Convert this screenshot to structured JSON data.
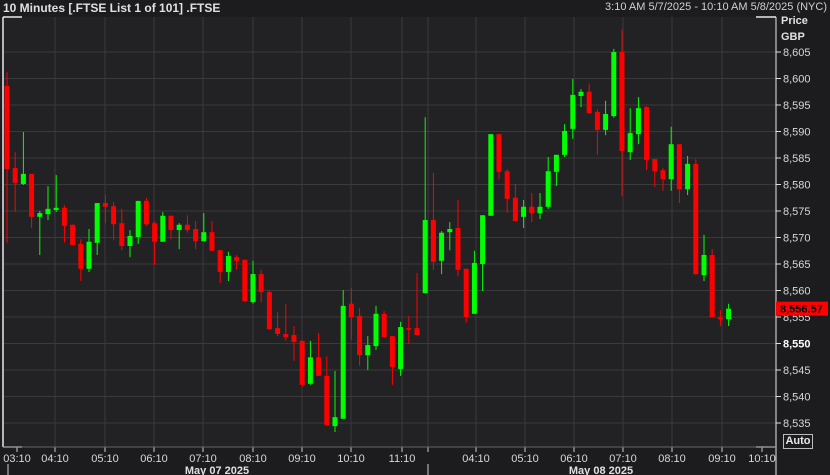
{
  "header": {
    "title": "10 Minutes [.FTSE List 1 of 101] .FTSE",
    "range": "3:10 AM 5/7/2025 - 10:10 AM 5/8/2025 (NYC)"
  },
  "axis": {
    "price_label": "Price",
    "currency_label": "GBP",
    "auto_label": "Auto",
    "last_price_label": "8,556.57",
    "price_ticks": [
      "8,605",
      "8,600",
      "8,595",
      "8,590",
      "8,585",
      "8,580",
      "8,575",
      "8,570",
      "8,565",
      "8,560",
      "8,555",
      "8,550",
      "8,545",
      "8,540",
      "8,535"
    ],
    "time_ticks": [
      "03:10",
      "04:10",
      "05:10",
      "06:10",
      "07:10",
      "08:10",
      "09:10",
      "10:10",
      "11:10",
      "",
      "04:10",
      "05:10",
      "06:10",
      "07:10",
      "08:10",
      "09:10",
      "10:10"
    ],
    "dates": [
      "May 07 2025",
      "May 08 2025"
    ]
  },
  "colors": {
    "up": "#00ff00",
    "down": "#ff0000",
    "last_price_bg": "#ff0000"
  },
  "chart_data": {
    "type": "candlestick",
    "title": "10 Minutes [.FTSE List 1 of 101] .FTSE",
    "ylabel": "Price GBP",
    "ylim": [
      8532,
      8612
    ],
    "last_price": 8556.57,
    "ohlc": [
      [
        8598.6,
        8601.2,
        8569.0,
        8582.9
      ],
      [
        8583.1,
        8586.1,
        8574.8,
        8580.3
      ],
      [
        8580.1,
        8589.9,
        8579.9,
        8582.0
      ],
      [
        8582.0,
        8582.0,
        8571.8,
        8573.9
      ],
      [
        8573.9,
        8575.0,
        8566.7,
        8574.6
      ],
      [
        8574.4,
        8579.7,
        8573.3,
        8575.4
      ],
      [
        8575.2,
        8581.8,
        8574.8,
        8575.6
      ],
      [
        8575.6,
        8576.1,
        8569.0,
        8572.2
      ],
      [
        8572.4,
        8572.4,
        8568.6,
        8568.6
      ],
      [
        8568.8,
        8569.7,
        8561.8,
        8564.1
      ],
      [
        8564.1,
        8571.6,
        8563.5,
        8569.2
      ],
      [
        8569.0,
        8576.5,
        8566.7,
        8576.5
      ],
      [
        8576.5,
        8578.0,
        8572.7,
        8575.8
      ],
      [
        8575.9,
        8576.7,
        8569.5,
        8572.5
      ],
      [
        8572.7,
        8575.4,
        8567.6,
        8568.4
      ],
      [
        8568.4,
        8571.4,
        8566.3,
        8570.3
      ],
      [
        8570.1,
        8576.9,
        8568.8,
        8576.9
      ],
      [
        8576.9,
        8577.5,
        8572.2,
        8572.5
      ],
      [
        8572.7,
        8573.1,
        8564.8,
        8569.2
      ],
      [
        8569.2,
        8574.8,
        8569.2,
        8574.1
      ],
      [
        8574.1,
        8574.1,
        8569.7,
        8571.4
      ],
      [
        8571.4,
        8572.7,
        8567.8,
        8572.4
      ],
      [
        8572.4,
        8574.2,
        8570.9,
        8571.4
      ],
      [
        8571.6,
        8573.1,
        8567.8,
        8569.3
      ],
      [
        8569.3,
        8574.6,
        8569.3,
        8571.0
      ],
      [
        8571.0,
        8573.1,
        8567.5,
        8567.5
      ],
      [
        8567.6,
        8567.6,
        8561.4,
        8563.5
      ],
      [
        8563.5,
        8567.3,
        8561.8,
        8566.5
      ],
      [
        8566.3,
        8566.7,
        8563.9,
        8565.6
      ],
      [
        8565.8,
        8565.8,
        8557.8,
        8558.0
      ],
      [
        8557.8,
        8565.6,
        8557.5,
        8563.1
      ],
      [
        8563.1,
        8563.9,
        8557.8,
        8559.7
      ],
      [
        8559.7,
        8560.1,
        8552.7,
        8552.7
      ],
      [
        8552.9,
        8555.9,
        8551.4,
        8551.8
      ],
      [
        8551.8,
        8557.5,
        8550.5,
        8551.2
      ],
      [
        8551.6,
        8553.3,
        8546.7,
        8550.3
      ],
      [
        8550.5,
        8550.5,
        8541.8,
        8542.2
      ],
      [
        8542.4,
        8550.5,
        8542.2,
        8547.4
      ],
      [
        8547.4,
        8552.0,
        8543.9,
        8543.9
      ],
      [
        8543.9,
        8547.6,
        8534.4,
        8534.6
      ],
      [
        8534.4,
        8544.8,
        8533.3,
        8536.1
      ],
      [
        8535.8,
        8560.1,
        8535.8,
        8557.1
      ],
      [
        8557.5,
        8560.5,
        8550.7,
        8555.0
      ],
      [
        8555.2,
        8556.7,
        8545.8,
        8547.8
      ],
      [
        8547.8,
        8551.4,
        8545.0,
        8549.7
      ],
      [
        8549.5,
        8557.1,
        8548.8,
        8555.6
      ],
      [
        8555.6,
        8556.1,
        8551.2,
        8551.2
      ],
      [
        8551.4,
        8551.4,
        8542.2,
        8545.6
      ],
      [
        8545.2,
        8554.1,
        8543.9,
        8553.1
      ],
      [
        8552.9,
        8555.2,
        8549.9,
        8552.7
      ],
      [
        8552.9,
        8563.3,
        8551.6,
        8551.6
      ],
      [
        8559.5,
        8592.7,
        8559.5,
        8573.3
      ],
      [
        8573.3,
        8582.2,
        8563.9,
        8565.4
      ],
      [
        8565.6,
        8571.2,
        8563.1,
        8570.9
      ],
      [
        8571.0,
        8572.9,
        8567.6,
        8571.6
      ],
      [
        8571.8,
        8577.1,
        8562.7,
        8563.9
      ],
      [
        8564.1,
        8564.1,
        8553.9,
        8555.0
      ],
      [
        8555.6,
        8567.5,
        8555.6,
        8565.2
      ],
      [
        8565.0,
        8574.2,
        8559.9,
        8574.2
      ],
      [
        8574.1,
        8589.5,
        8574.1,
        8589.5
      ],
      [
        8589.5,
        8589.5,
        8581.0,
        8582.4
      ],
      [
        8582.5,
        8582.9,
        8574.6,
        8577.3
      ],
      [
        8577.5,
        8580.1,
        8573.1,
        8573.1
      ],
      [
        8573.9,
        8577.1,
        8571.8,
        8575.8
      ],
      [
        8575.8,
        8578.4,
        8572.9,
        8574.6
      ],
      [
        8574.6,
        8578.4,
        8573.5,
        8575.8
      ],
      [
        8575.8,
        8585.2,
        8575.4,
        8582.5
      ],
      [
        8582.4,
        8585.6,
        8579.7,
        8585.6
      ],
      [
        8585.6,
        8591.4,
        8585.2,
        8590.1
      ],
      [
        8590.5,
        8599.9,
        8588.6,
        8596.9
      ],
      [
        8596.7,
        8598.0,
        8594.6,
        8597.5
      ],
      [
        8597.5,
        8599.0,
        8593.3,
        8593.5
      ],
      [
        8593.7,
        8594.2,
        8585.6,
        8590.3
      ],
      [
        8590.3,
        8595.8,
        8589.3,
        8593.3
      ],
      [
        8592.9,
        8605.6,
        8592.6,
        8605.0
      ],
      [
        8605.0,
        8609.2,
        8577.8,
        8586.3
      ],
      [
        8586.1,
        8594.4,
        8584.6,
        8589.7
      ],
      [
        8589.5,
        8596.5,
        8587.6,
        8594.4
      ],
      [
        8594.6,
        8594.8,
        8582.7,
        8584.6
      ],
      [
        8584.8,
        8584.8,
        8579.5,
        8582.5
      ],
      [
        8582.7,
        8583.1,
        8578.8,
        8581.0
      ],
      [
        8581.0,
        8590.9,
        8578.8,
        8587.6
      ],
      [
        8587.6,
        8587.6,
        8576.5,
        8579.1
      ],
      [
        8579.1,
        8585.4,
        8578.0,
        8583.9
      ],
      [
        8583.9,
        8584.8,
        8562.9,
        8563.1
      ],
      [
        8562.9,
        8570.5,
        8561.8,
        8566.7
      ],
      [
        8566.7,
        8567.8,
        8554.9,
        8554.9
      ],
      [
        8554.9,
        8556.3,
        8553.3,
        8554.6
      ],
      [
        8554.6,
        8557.5,
        8553.3,
        8556.57
      ]
    ]
  }
}
